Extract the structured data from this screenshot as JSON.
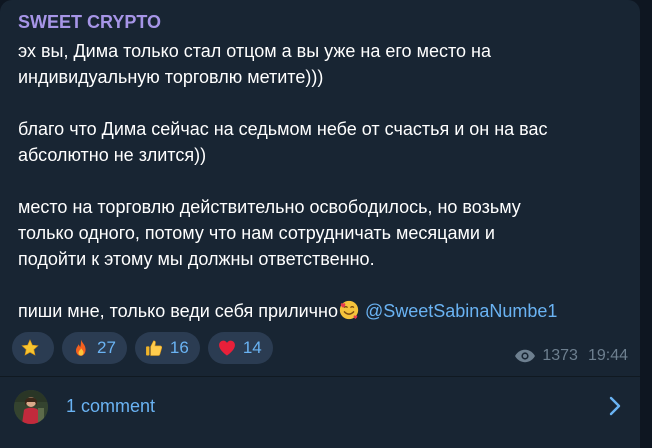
{
  "post": {
    "channel_name": "SWEET CRYPTO",
    "paragraphs": [
      "эх вы, Дима только стал отцом а вы уже на его место на\nиндивидуальную торговлю метите)))",
      "благо что Дима сейчас на седьмом небе от счастья и он на вас\nабсолютно не злится))",
      "место на торговлю действительно освободилось, но возьму\nтолько одного, потому что нам сотрудничать месяцами и\nподойти к этому мы должны ответственно."
    ],
    "last_line_text": "пиши мне, только веди себя прилично",
    "last_line_emoji": "smiling-face-with-hearts",
    "mention": "@SweetSabinaNumbe1"
  },
  "reactions": [
    {
      "emoji": "star",
      "count": ""
    },
    {
      "emoji": "fire",
      "count": "27"
    },
    {
      "emoji": "thumbs-up",
      "count": "16"
    },
    {
      "emoji": "red-heart",
      "count": "14"
    }
  ],
  "meta": {
    "views": "1373",
    "time": "19:44"
  },
  "comments": {
    "label": "1 comment"
  },
  "colors": {
    "background": "#0e1621",
    "bubble": "#182533",
    "channel_name": "#a695e7",
    "accent": "#6ab3f3",
    "meta": "#6d7f8f",
    "reaction_bg": "#2b3c52"
  }
}
